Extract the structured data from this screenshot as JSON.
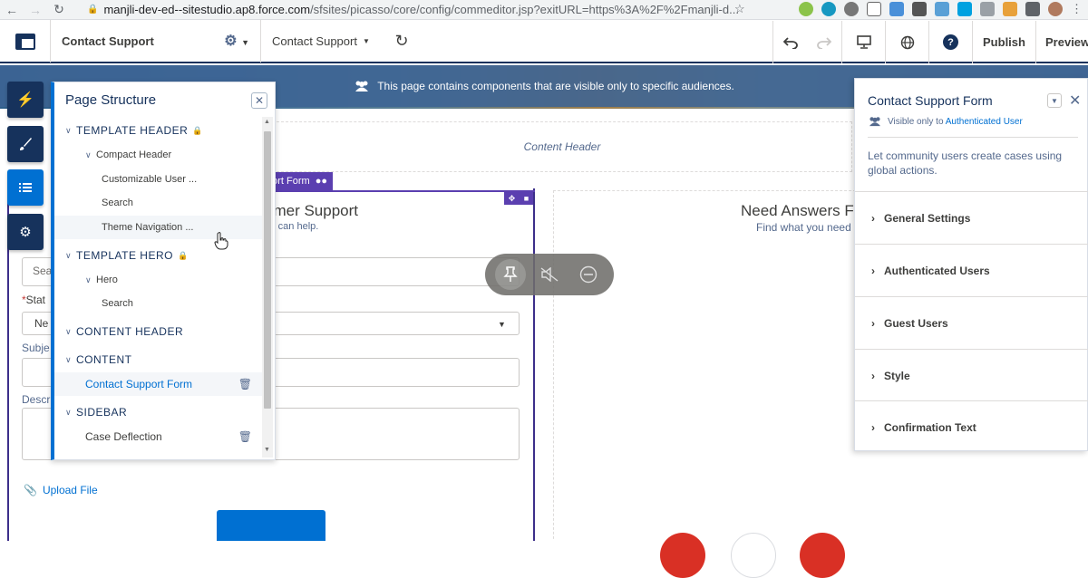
{
  "browser": {
    "url_host": "manjli-dev-ed--sitestudio.ap8.force.com",
    "url_path": "/sfsites/picasso/core/config/commeditor.jsp?exitURL=https%3A%2F%2Fmanjli-d..."
  },
  "header": {
    "site_name": "Contact Support",
    "page_name": "Contact Support",
    "publish_label": "Publish",
    "preview_label": "Preview"
  },
  "canvas": {
    "audience_banner": "This page contains components that are visible only to specific audiences.",
    "content_header_label": "Content Header",
    "component_tag": "port Form",
    "form_title": "omer Support",
    "form_subtitle": "ve can help.",
    "answers_title": "Need Answers F",
    "answers_subtitle": "Find what you need h",
    "search_placeholder": "Sea",
    "status_label": "Stat",
    "status_value": "Ne",
    "subject_label": "Subje",
    "description_label": "Descr",
    "upload_label": "Upload File"
  },
  "structure": {
    "title": "Page Structure",
    "items": [
      {
        "label": "TEMPLATE HEADER"
      },
      {
        "label": "Compact Header"
      },
      {
        "label": "Customizable User ..."
      },
      {
        "label": "Search"
      },
      {
        "label": "Theme Navigation ..."
      },
      {
        "label": "TEMPLATE HERO"
      },
      {
        "label": "Hero"
      },
      {
        "label": "Search"
      },
      {
        "label": "CONTENT HEADER"
      },
      {
        "label": "CONTENT"
      },
      {
        "label": "Contact Support Form"
      },
      {
        "label": "SIDEBAR"
      },
      {
        "label": "Case Deflection"
      }
    ]
  },
  "props": {
    "title": "Contact Support Form",
    "visible_prefix": "Visible only to",
    "visible_audience": "Authenticated User",
    "description": "Let community users create cases using global actions.",
    "sections": [
      {
        "label": "General Settings"
      },
      {
        "label": "Authenticated Users"
      },
      {
        "label": "Guest Users"
      },
      {
        "label": "Style"
      },
      {
        "label": "Confirmation Text"
      }
    ]
  },
  "colors": {
    "brand_navy": "#16325c",
    "brand_blue": "#0070d2",
    "component_purple": "#5b3fb0"
  }
}
